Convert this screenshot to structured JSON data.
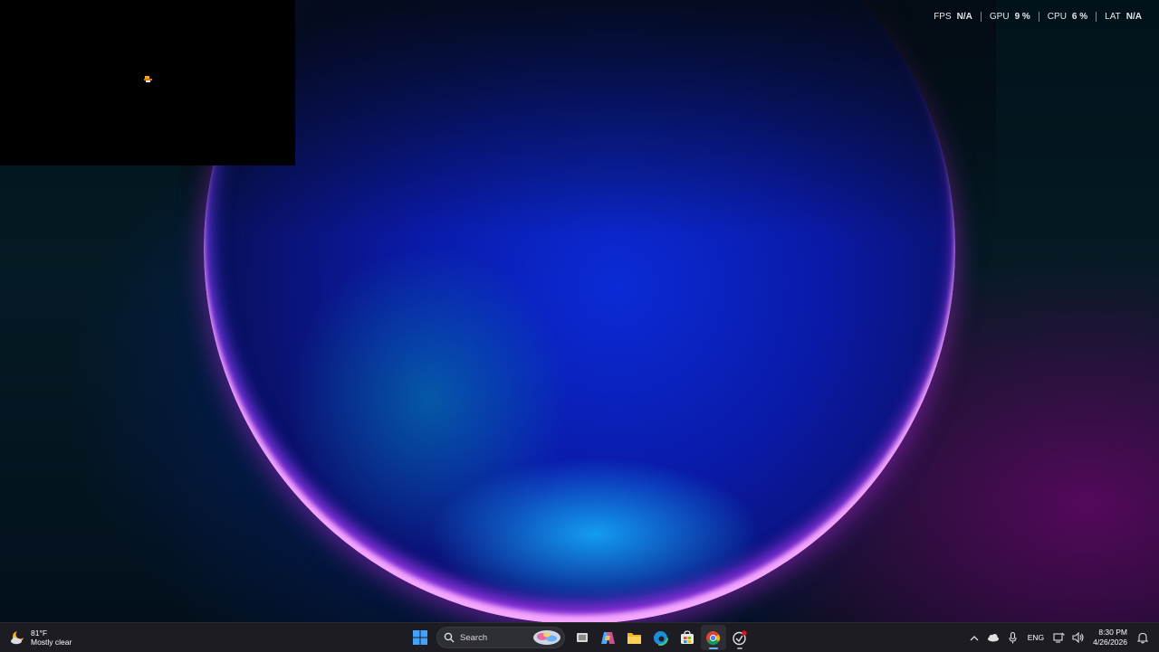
{
  "performance_overlay": {
    "items": [
      {
        "label": "FPS",
        "value": "N/A"
      },
      {
        "label": "GPU",
        "value": "9 %"
      },
      {
        "label": "CPU",
        "value": "6 %"
      },
      {
        "label": "LAT",
        "value": "N/A"
      }
    ]
  },
  "taskbar": {
    "weather": {
      "temperature": "81°F",
      "condition": "Mostly clear",
      "icon": "moon-cloud-icon"
    },
    "search": {
      "label": "Search"
    },
    "pinned_apps": [
      {
        "name": "start-button",
        "icon": "windows-logo-icon"
      },
      {
        "name": "task-view-button",
        "icon": "task-view-icon"
      },
      {
        "name": "copilot-button",
        "icon": "copilot-icon"
      },
      {
        "name": "file-explorer-button",
        "icon": "folder-icon"
      },
      {
        "name": "edge-button",
        "icon": "edge-icon"
      },
      {
        "name": "store-button",
        "icon": "store-icon"
      },
      {
        "name": "chrome-button",
        "icon": "chrome-icon",
        "active": true
      },
      {
        "name": "app-button",
        "icon": "app-icon",
        "badge": true
      }
    ],
    "tray": {
      "language": "ENG",
      "time": "8:30 PM",
      "date": "4/26/2026"
    }
  },
  "colors": {
    "taskbar_bg": "#1c1c22",
    "accent": "#6ab0ff",
    "badge": "#e81123"
  }
}
